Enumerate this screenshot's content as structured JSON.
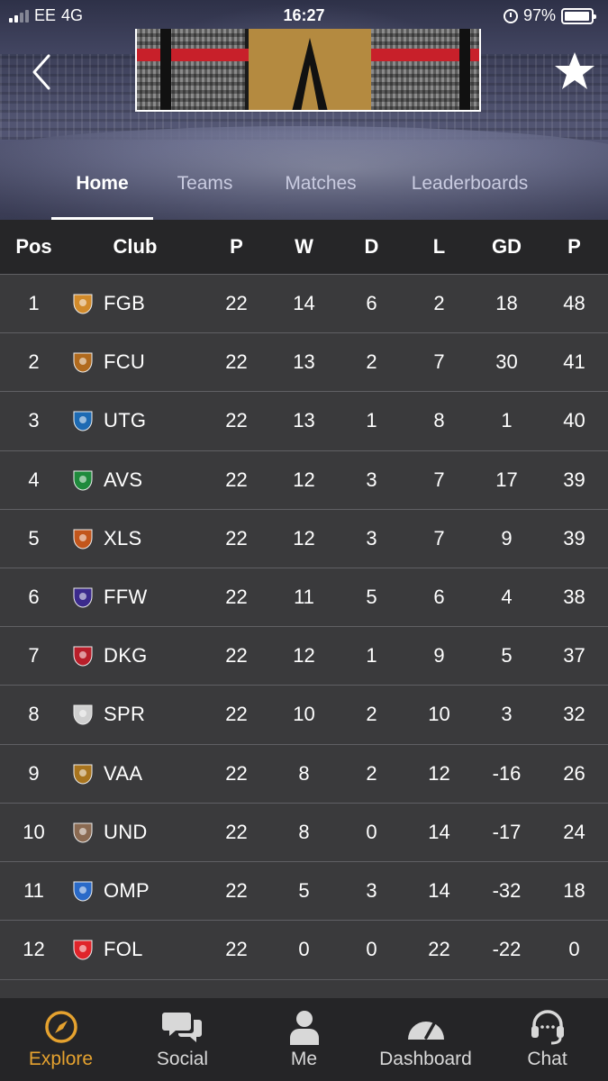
{
  "status_bar": {
    "carrier": "EE",
    "network": "4G",
    "time": "16:27",
    "battery": "97%"
  },
  "tabs": [
    {
      "label": "Home",
      "active": true
    },
    {
      "label": "Teams",
      "active": false
    },
    {
      "label": "Matches",
      "active": false
    },
    {
      "label": "Leaderboards",
      "active": false
    }
  ],
  "table": {
    "headers": [
      "Pos",
      "Club",
      "P",
      "W",
      "D",
      "L",
      "GD",
      "P"
    ],
    "rows": [
      {
        "pos": "1",
        "club": "FGB",
        "p": "22",
        "w": "14",
        "d": "6",
        "l": "2",
        "gd": "18",
        "pts": "48",
        "badge_color": "#d18a2a"
      },
      {
        "pos": "2",
        "club": "FCU",
        "p": "22",
        "w": "13",
        "d": "2",
        "l": "7",
        "gd": "30",
        "pts": "41",
        "badge_color": "#b06a1e"
      },
      {
        "pos": "3",
        "club": "UTG",
        "p": "22",
        "w": "13",
        "d": "1",
        "l": "8",
        "gd": "1",
        "pts": "40",
        "badge_color": "#1d6ab3"
      },
      {
        "pos": "4",
        "club": "AVS",
        "p": "22",
        "w": "12",
        "d": "3",
        "l": "7",
        "gd": "17",
        "pts": "39",
        "badge_color": "#1f8a3c"
      },
      {
        "pos": "5",
        "club": "XLS",
        "p": "22",
        "w": "12",
        "d": "3",
        "l": "7",
        "gd": "9",
        "pts": "39",
        "badge_color": "#c2561c"
      },
      {
        "pos": "6",
        "club": "FFW",
        "p": "22",
        "w": "11",
        "d": "5",
        "l": "6",
        "gd": "4",
        "pts": "38",
        "badge_color": "#3b2a8c"
      },
      {
        "pos": "7",
        "club": "DKG",
        "p": "22",
        "w": "12",
        "d": "1",
        "l": "9",
        "gd": "5",
        "pts": "37",
        "badge_color": "#b81e2a"
      },
      {
        "pos": "8",
        "club": "SPR",
        "p": "22",
        "w": "10",
        "d": "2",
        "l": "10",
        "gd": "3",
        "pts": "32",
        "badge_color": "#cfcfcf"
      },
      {
        "pos": "9",
        "club": "VAA",
        "p": "22",
        "w": "8",
        "d": "2",
        "l": "12",
        "gd": "-16",
        "pts": "26",
        "badge_color": "#a8741e"
      },
      {
        "pos": "10",
        "club": "UND",
        "p": "22",
        "w": "8",
        "d": "0",
        "l": "14",
        "gd": "-17",
        "pts": "24",
        "badge_color": "#8a6a52"
      },
      {
        "pos": "11",
        "club": "OMP",
        "p": "22",
        "w": "5",
        "d": "3",
        "l": "14",
        "gd": "-32",
        "pts": "18",
        "badge_color": "#2a6ac8"
      },
      {
        "pos": "12",
        "club": "FOL",
        "p": "22",
        "w": "0",
        "d": "0",
        "l": "22",
        "gd": "-22",
        "pts": "0",
        "badge_color": "#e0242a"
      }
    ]
  },
  "bottom_nav": [
    {
      "label": "Explore",
      "icon": "compass-icon",
      "active": true
    },
    {
      "label": "Social",
      "icon": "chat-bubbles-icon",
      "active": false
    },
    {
      "label": "Me",
      "icon": "person-icon",
      "active": false
    },
    {
      "label": "Dashboard",
      "icon": "gauge-icon",
      "active": false
    },
    {
      "label": "Chat",
      "icon": "headset-icon",
      "active": false
    }
  ],
  "colors": {
    "accent": "#e5a22f",
    "background": "#3a3a3c",
    "header_row": "#262628",
    "tabbar": "#252527"
  }
}
